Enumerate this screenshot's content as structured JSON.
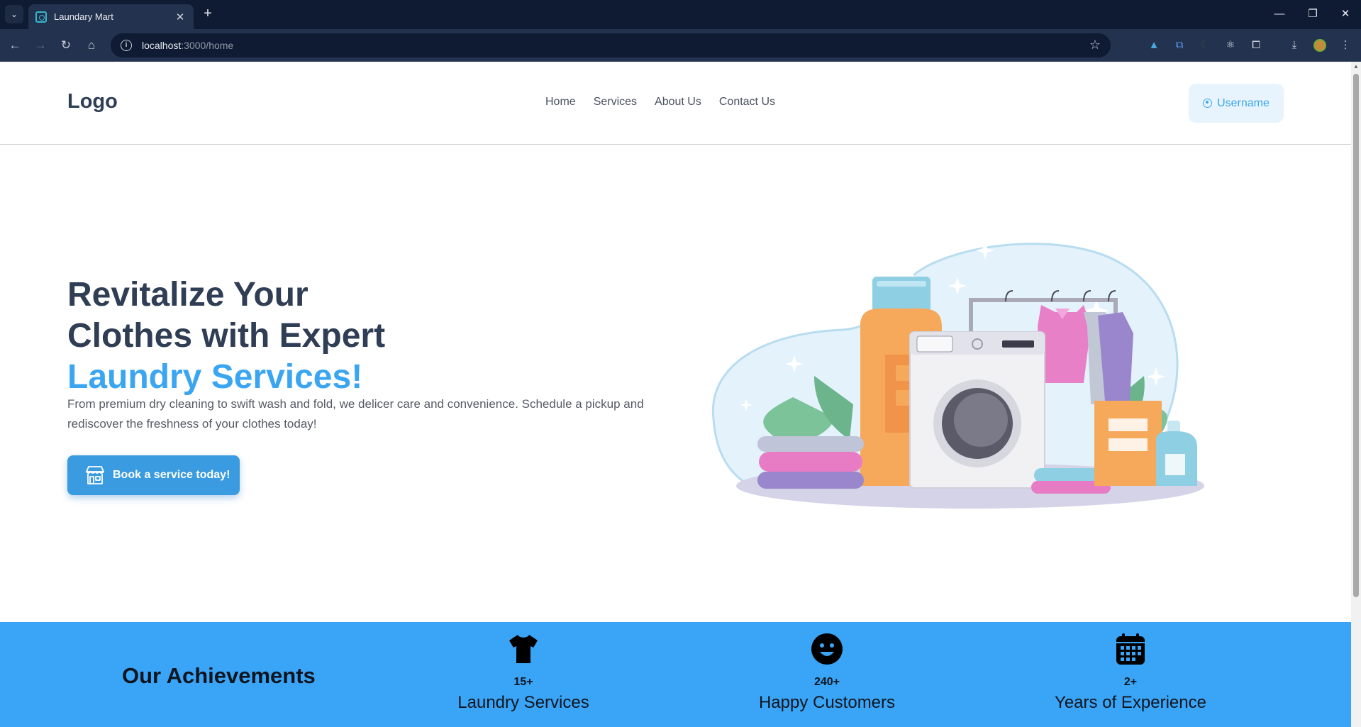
{
  "browser": {
    "tab_title": "Laundary Mart",
    "url_host": "localhost",
    "url_path": ":3000/home"
  },
  "header": {
    "logo": "Logo",
    "nav": [
      "Home",
      "Services",
      "About Us",
      "Contact Us"
    ],
    "username": "Username"
  },
  "hero": {
    "title_line1": "Revitalize Your",
    "title_line2": "Clothes with Expert",
    "title_accent": "Laundry Services!",
    "description": "From premium dry cleaning to swift wash and fold, we delicer care and convenience. Schedule a pickup and rediscover the freshness of your clothes today!",
    "cta": "Book a service today!"
  },
  "achievements": {
    "title": "Our Achievements",
    "stats": [
      {
        "icon": "tshirt-icon",
        "value": "15+",
        "label": "Laundry Services"
      },
      {
        "icon": "smiley-icon",
        "value": "240+",
        "label": "Happy Customers"
      },
      {
        "icon": "calendar-icon",
        "value": "2+",
        "label": "Years of Experience"
      }
    ]
  },
  "colors": {
    "accent": "#3aa5f1",
    "heading": "#2f3e54",
    "achievements_bg": "#3aa5f6"
  }
}
